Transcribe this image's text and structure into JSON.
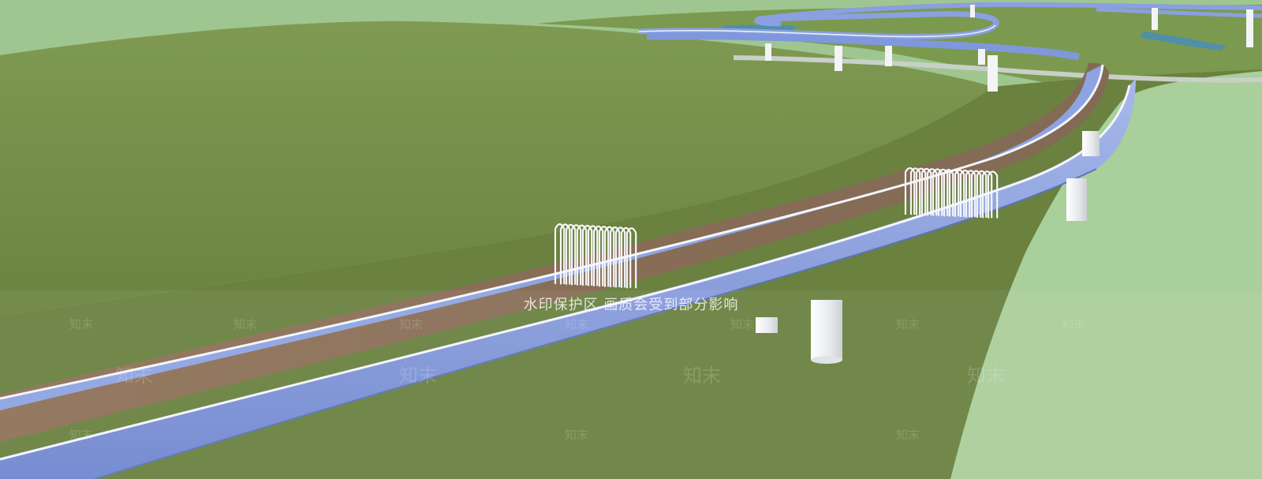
{
  "scene": {
    "subject": "elevated-walkway-render",
    "palette": {
      "sky_hill_light": "#9ec48e",
      "grass_dark": "#6f8744",
      "grass_mid": "#7b9350",
      "grass_light": "#a7cc98",
      "deck_brown": "#8a6f57",
      "rail_blue": "#7f98dc",
      "rail_edge": "#f2f4fa",
      "pier_white": "#eef0f2"
    }
  },
  "watermark": {
    "notice": "水印保护区  画质会受到部分影响",
    "tag": "知末"
  }
}
